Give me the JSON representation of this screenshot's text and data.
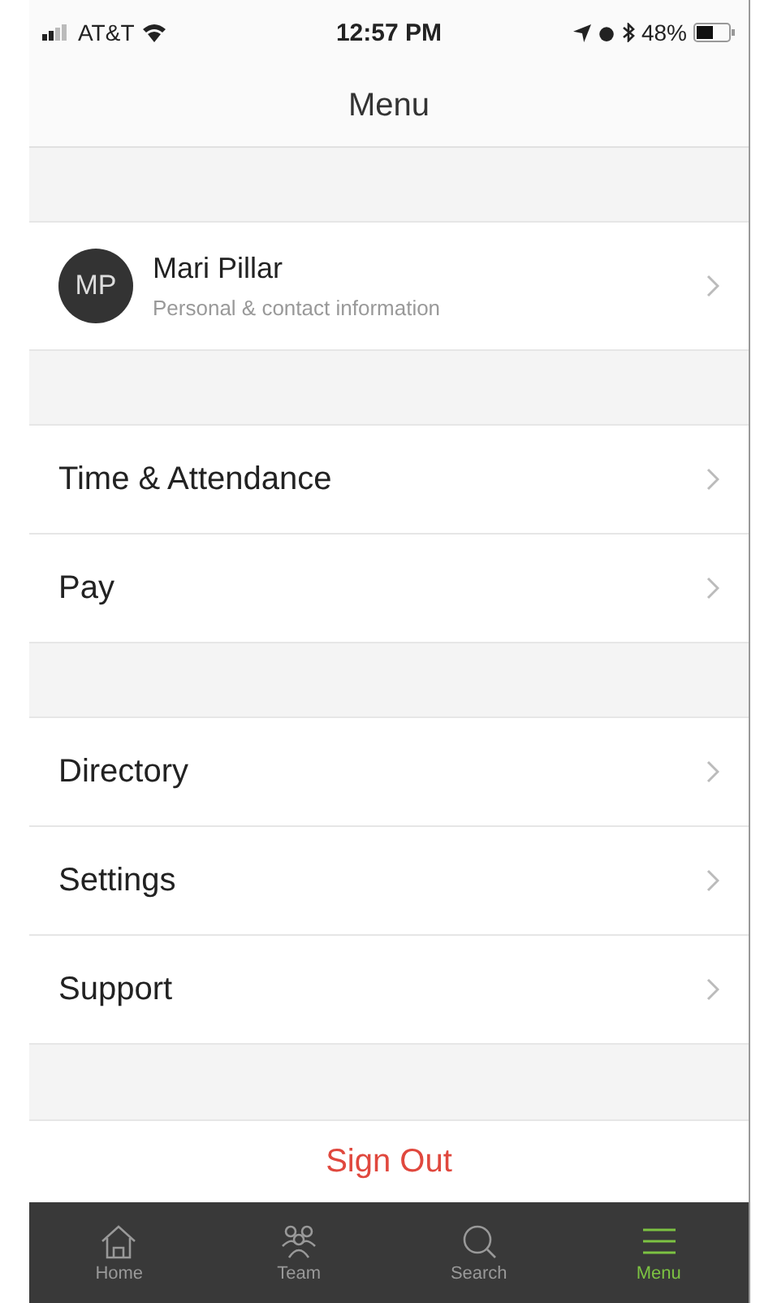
{
  "status_bar": {
    "carrier": "AT&T",
    "time": "12:57 PM",
    "battery": "48%"
  },
  "title": "Menu",
  "profile": {
    "initials": "MP",
    "name": "Mari Pillar",
    "subtitle": "Personal & contact information"
  },
  "sections": [
    {
      "items": [
        {
          "label": "Time & Attendance"
        },
        {
          "label": "Pay"
        }
      ]
    },
    {
      "items": [
        {
          "label": "Directory"
        },
        {
          "label": "Settings"
        },
        {
          "label": "Support"
        }
      ]
    }
  ],
  "sign_out": "Sign Out",
  "tabs": [
    {
      "label": "Home",
      "selected": false
    },
    {
      "label": "Team",
      "selected": false
    },
    {
      "label": "Search",
      "selected": false
    },
    {
      "label": "Menu",
      "selected": true
    }
  ]
}
